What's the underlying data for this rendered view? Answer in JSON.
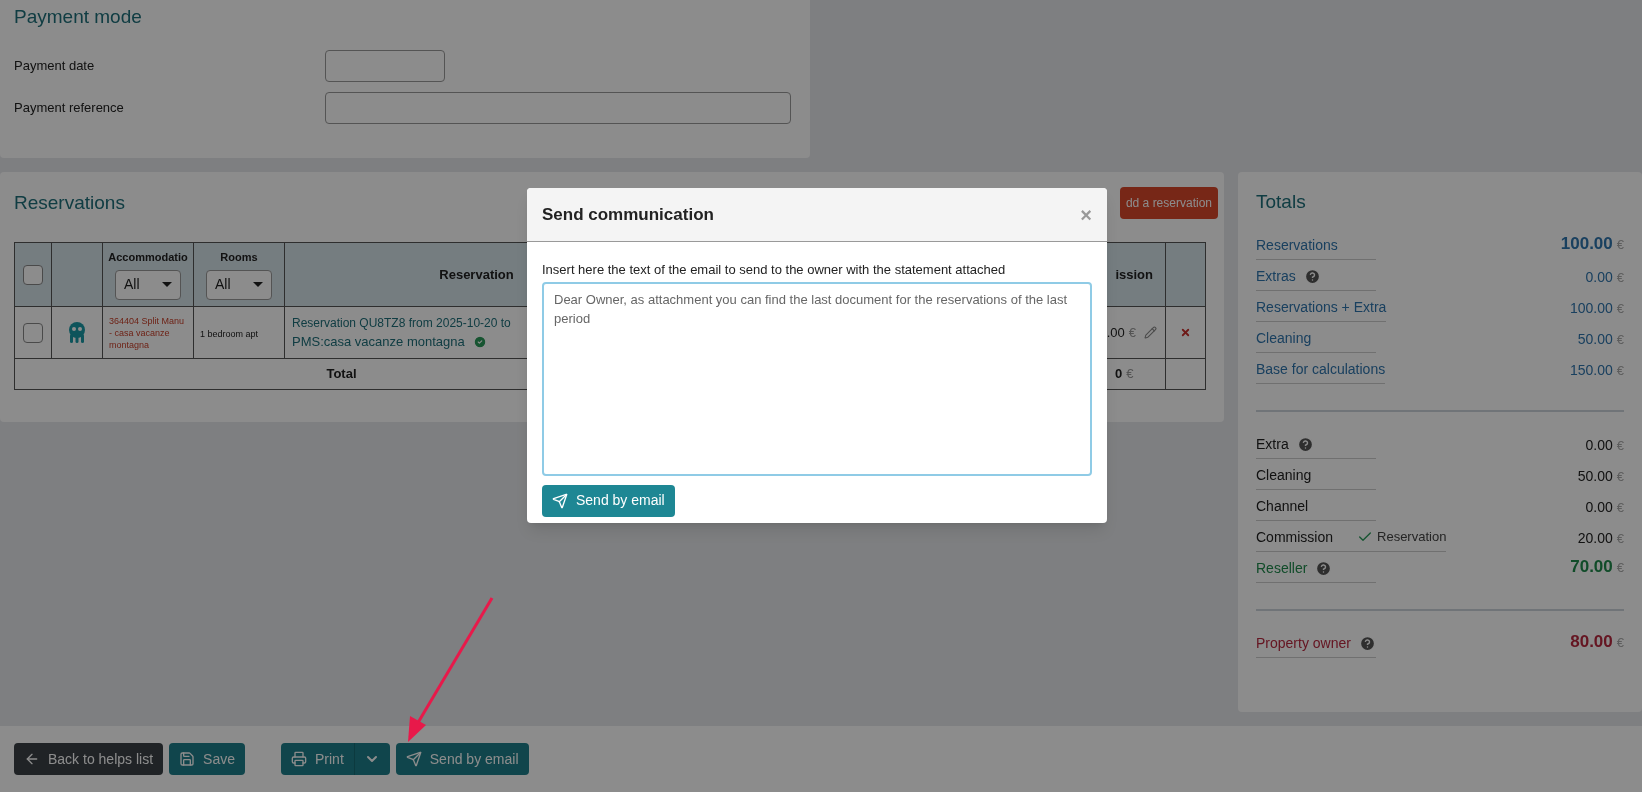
{
  "payment": {
    "title": "Payment mode",
    "fields": [
      {
        "label": "Payment date",
        "kind": "short"
      },
      {
        "label": "Payment reference",
        "kind": "long"
      }
    ]
  },
  "reservations": {
    "title": "Reservations",
    "add_button": "dd a reservation",
    "select_all": {
      "checked": false
    },
    "columns": [
      {
        "label": "Accommodatio",
        "filter": "All"
      },
      {
        "label": "Rooms",
        "filter": "All"
      },
      {
        "label": "Reservation"
      },
      {
        "label": "ission"
      }
    ],
    "rows": [
      {
        "checked": false,
        "accommodation": "364404 Split Manu - casa vacanze montagna",
        "room": "1 bedroom apt",
        "reservation": "Reservation QU8TZ8 from 2025-10-20 to",
        "source": "PMS:casa vacanze montagna",
        "confirmed": true,
        "commission": ".00",
        "currency": "€"
      }
    ],
    "total": {
      "label": "Total",
      "commission": "0",
      "currency": "€"
    }
  },
  "totals": {
    "title": "Totals",
    "sections": [
      {
        "rows": [
          {
            "kind": "link",
            "label": "Reservations",
            "help": false,
            "emphasis": true,
            "value": "100.00",
            "currency": "€"
          },
          {
            "kind": "link",
            "label": "Extras",
            "help": true,
            "emphasis": false,
            "value": "0.00",
            "currency": "€"
          },
          {
            "kind": "link",
            "label": "Reservations + Extra",
            "help": false,
            "emphasis": false,
            "value": "100.00",
            "currency": "€"
          },
          {
            "kind": "link",
            "label": "Cleaning",
            "help": false,
            "emphasis": false,
            "value": "50.00",
            "currency": "€"
          },
          {
            "kind": "link",
            "label": "Base for calculations",
            "help": false,
            "emphasis": false,
            "value": "150.00",
            "currency": "€"
          }
        ]
      },
      {
        "rows": [
          {
            "kind": "plain",
            "label": "Extra",
            "help": true,
            "emphasis": false,
            "value": "0.00",
            "currency": "€"
          },
          {
            "kind": "plain",
            "label": "Cleaning",
            "help": false,
            "emphasis": false,
            "value": "50.00",
            "currency": "€"
          },
          {
            "kind": "plain",
            "label": "Channel",
            "help": false,
            "emphasis": false,
            "value": "0.00",
            "currency": "€"
          },
          {
            "kind": "plain",
            "label": "Commission",
            "help": false,
            "emphasis": false,
            "tag": {
              "label": "Reservation",
              "checked": true
            },
            "value": "20.00",
            "currency": "€"
          },
          {
            "kind": "reseller",
            "label": "Reseller",
            "help": true,
            "emphasis": true,
            "value": "70.00",
            "currency": "€"
          }
        ]
      },
      {
        "rows": [
          {
            "kind": "owner",
            "label": "Property owner",
            "help": true,
            "emphasis": true,
            "value": "80.00",
            "currency": "€"
          }
        ]
      }
    ]
  },
  "footer": {
    "buttons": [
      {
        "kind": "back",
        "label": "Back to helps list"
      },
      {
        "kind": "save",
        "label": "Save"
      },
      {
        "kind": "print",
        "label": "Print"
      },
      {
        "kind": "email",
        "label": "Send by email"
      }
    ]
  },
  "modal": {
    "title": "Send communication",
    "close": "×",
    "prompt": "Insert here the text of the email to send to the owner with the statement attached",
    "placeholder": "Dear Owner, as attachment you can find the last document for the reservations of the last period",
    "send_button": "Send by email"
  }
}
